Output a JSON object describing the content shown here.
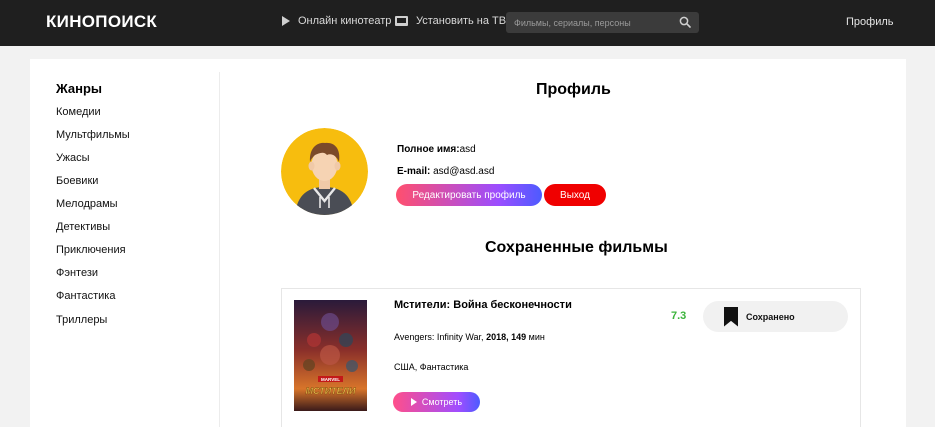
{
  "header": {
    "logo": "КИНОПОИСК",
    "nav_online": "Онлайн кинотеатр",
    "nav_tv": "Установить на ТВ",
    "search_placeholder": "Фильмы, сериалы, персоны",
    "profile_link": "Профиль"
  },
  "sidebar": {
    "title": "Жанры",
    "items": [
      {
        "label": "Комедии"
      },
      {
        "label": "Мультфильмы"
      },
      {
        "label": "Ужасы"
      },
      {
        "label": "Боевики"
      },
      {
        "label": "Мелодрамы"
      },
      {
        "label": "Детективы"
      },
      {
        "label": "Приключения"
      },
      {
        "label": "Фэнтези"
      },
      {
        "label": "Фантастика"
      },
      {
        "label": "Триллеры"
      }
    ]
  },
  "profile": {
    "title": "Профиль",
    "name_label": "Полное имя:",
    "name_value": "asd",
    "email_label": "E-mail:",
    "email_value": "asd@asd.asd",
    "edit_button": "Редактировать профиль",
    "exit_button": "Выход"
  },
  "saved": {
    "title": "Сохраненные фильмы",
    "films": [
      {
        "title": "Мстители: Война бесконечности",
        "original_title": "Avengers: Infinity War,",
        "year": "2018,",
        "duration_value": "149",
        "duration_unit": "мин",
        "country_genre": "США, Фантастика",
        "rating": "7.3",
        "saved_label": "Сохранено",
        "watch_label": "Смотреть",
        "poster_badge": "MARVEL",
        "poster_logo": "МСТИТЕЛИ"
      }
    ]
  },
  "colors": {
    "header_bg": "#1f1f1f",
    "rating": "#3bb33b",
    "exit": "#f00000",
    "accent_gradient_start": "#ff4f6e",
    "accent_gradient_end": "#4d5bff"
  }
}
